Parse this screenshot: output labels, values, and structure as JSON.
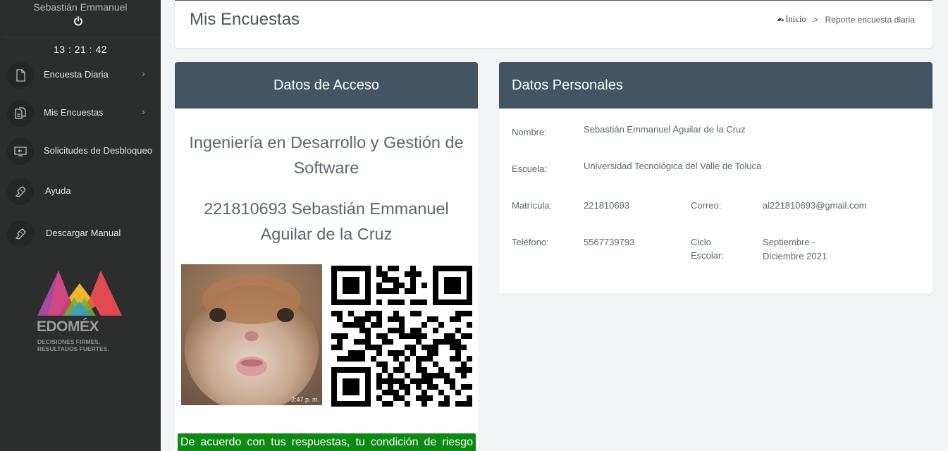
{
  "sidebar": {
    "user_name": "Sebastián Emmanuel",
    "clock": "13 : 21 : 42",
    "items": [
      {
        "label": "Encuesta Diaria",
        "icon": "document-icon",
        "has_chevron": true
      },
      {
        "label": "Mis Encuestas",
        "icon": "documents-icon",
        "has_chevron": true
      },
      {
        "label": "Solicitudes de Desbloqueo",
        "icon": "monitor-return-icon",
        "has_chevron": true
      },
      {
        "label": "Ayuda",
        "icon": "hand-help-icon",
        "has_chevron": false
      },
      {
        "label": "Descargar Manual",
        "icon": "hand-help-icon",
        "has_chevron": false
      }
    ],
    "logo": {
      "name": "EDOMÉX",
      "tagline_1": "DECISIONES FIRMES,",
      "tagline_2": "RESULTADOS FUERTES."
    }
  },
  "header": {
    "title": "Mis Encuestas",
    "breadcrumb": {
      "home": "Inicio",
      "separator": ">",
      "current": "Reporte encuesta diaria"
    }
  },
  "access": {
    "title": "Datos de Acceso",
    "career": "Ingeniería en Desarrollo y Gestión de Software",
    "student": "221810693 Sebastián Emmanuel Aguilar de la Cruz",
    "photo_time": "3:47 p. m.",
    "risk_text": "De acuerdo con tus respuestas, tu condición de riesgo"
  },
  "personal": {
    "title": "Datos Personales",
    "nombre_label": "Nombre:",
    "nombre": "Sebastián Emmanuel Aguilar de la Cruz",
    "escuela_label": "Escuela:",
    "escuela": "Universidad Tecnológica del Valle de Toluca",
    "matricula_label": "Matrícula:",
    "matricula": "221810693",
    "correo_label": "Correo:",
    "correo": "al221810693@gmail.com",
    "telefono_label": "Teléfono:",
    "telefono": "5567739793",
    "ciclo_label_1": "Ciclo",
    "ciclo_label_2": "Escolar:",
    "ciclo_1": "Septiembre -",
    "ciclo_2": "Diciembre 2021"
  },
  "colors": {
    "sidebar_bg": "#2c2d2d",
    "card_header": "#435562",
    "risk_green": "#0c8a12",
    "page_bg": "#f3f4f5"
  }
}
